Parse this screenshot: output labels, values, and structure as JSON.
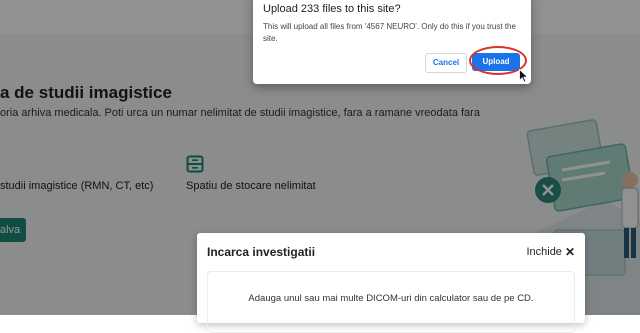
{
  "page": {
    "headline": "a de studii imagistice",
    "intro": "oria arhiva medicala. Poti urca un numar nelimitat de studii imagistice, fara a ramane vreodata fara",
    "feature_unlimited_studies": "studii imagistice (RMN, CT, etc)",
    "feature_unlimited_storage": "Spatiu de stocare nelimitat",
    "feature_icon": "storage-icon",
    "save_button": "alva",
    "accent_color": "#1d8a7a"
  },
  "upload_dialog": {
    "title": "Upload 233 files to this site?",
    "message": "This will upload all files from '4567 NEURO'. Only do this if you trust the site.",
    "cancel_label": "Cancel",
    "upload_label": "Upload",
    "upload_color": "#1a73e8",
    "highlight_color": "#d8322f"
  },
  "modal": {
    "title": "Incarca investigatii",
    "close_label": "Inchide",
    "close_icon": "close-icon",
    "dropzone_text": "Adauga unul sau mai multe DICOM-uri din calculator sau de pe CD."
  }
}
